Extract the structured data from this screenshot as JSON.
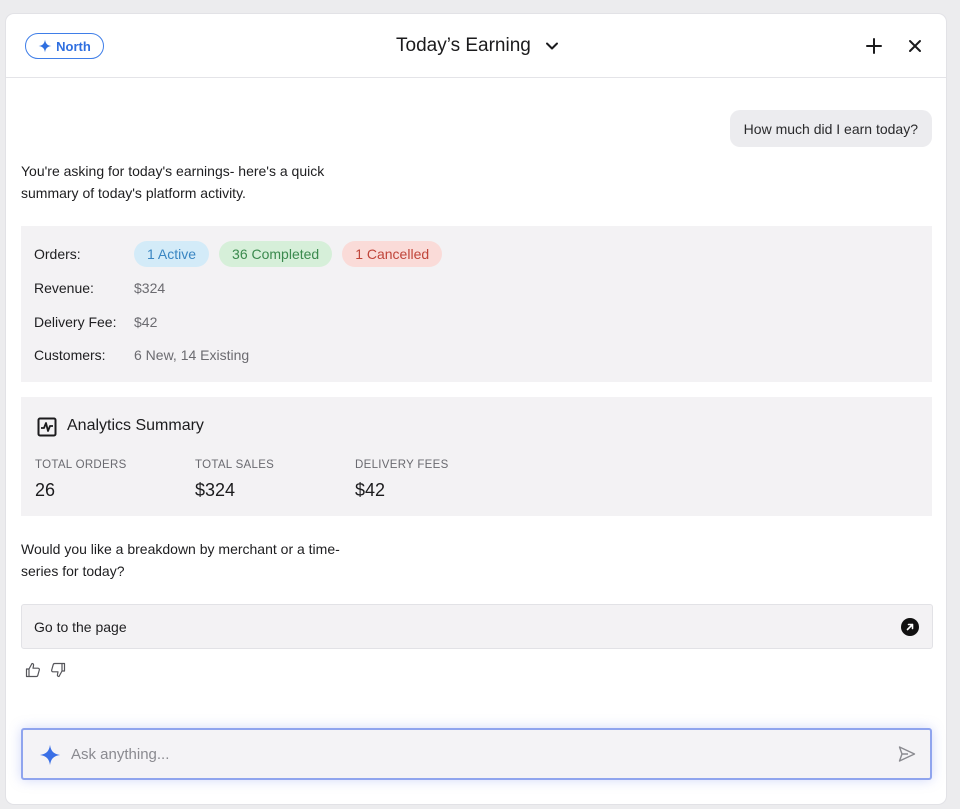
{
  "header": {
    "badge_label": "North",
    "title": "Today’s Earning"
  },
  "conversation": {
    "user_message": "How much did I earn today?",
    "bot_intro": "You're asking for today's earnings- here's a quick summary of today's platform activity.",
    "summary": {
      "orders_label": "Orders:",
      "order_pills": [
        {
          "label": "1 Active",
          "bg": "#d3ebf8",
          "color": "#3a86c2"
        },
        {
          "label": "36 Completed",
          "bg": "#d6efd9",
          "color": "#3b8a4e"
        },
        {
          "label": "1 Cancelled",
          "bg": "#fadbd8",
          "color": "#c0453a"
        }
      ],
      "revenue_label": "Revenue:",
      "revenue_value": "$324",
      "delivery_fee_label": "Delivery Fee:",
      "delivery_fee_value": "$42",
      "customers_label": "Customers:",
      "customers_value": "6 New, 14 Existing"
    },
    "analytics": {
      "title": "Analytics Summary",
      "icon": "chart-icon",
      "stats": [
        {
          "caption": "TOTAL ORDERS",
          "value": "26"
        },
        {
          "caption": "TOTAL SALES",
          "value": "$324"
        },
        {
          "caption": "DELIVERY FEES",
          "value": "$42"
        }
      ]
    },
    "followup": "Would you like a breakdown by merchant or a time-series for today?",
    "goto_label": "Go to the page"
  },
  "composer": {
    "placeholder": "Ask anything..."
  },
  "colors": {
    "accent": "#3f7ee8",
    "input_border": "#8fa4ee"
  }
}
